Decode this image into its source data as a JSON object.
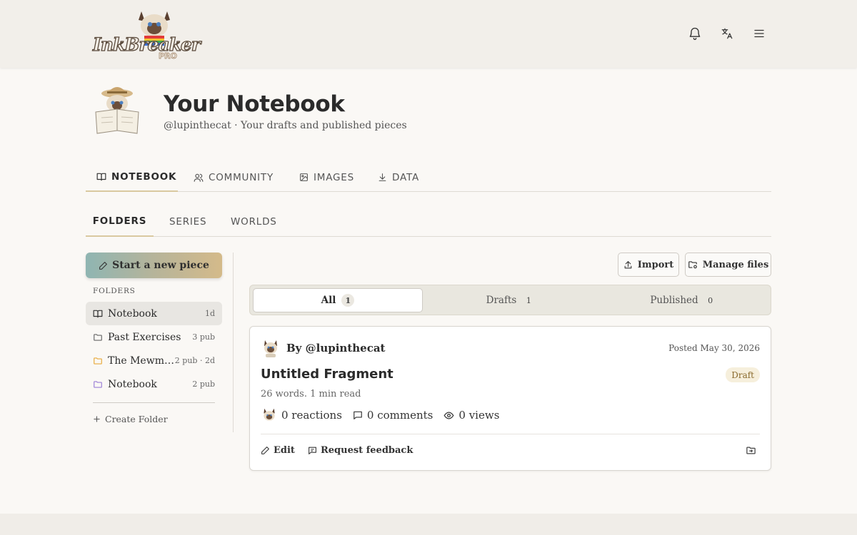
{
  "header": {
    "logo_text": "InkBreaker",
    "logo_sub": "PRO",
    "icons": [
      "bell-icon",
      "translate-icon",
      "menu-icon"
    ]
  },
  "profile": {
    "title": "Your Notebook",
    "subtitle": "@lupinthecat · Your drafts and published pieces"
  },
  "main_tabs": [
    {
      "label": "NOTEBOOK",
      "icon": "book-icon",
      "active": true
    },
    {
      "label": "COMMUNITY",
      "icon": "users-icon",
      "active": false
    },
    {
      "label": "IMAGES",
      "icon": "image-icon",
      "active": false
    },
    {
      "label": "DATA",
      "icon": "download-icon",
      "active": false
    }
  ],
  "sub_tabs": [
    {
      "label": "FOLDERS",
      "active": true
    },
    {
      "label": "SERIES",
      "active": false
    },
    {
      "label": "WORLDS",
      "active": false
    }
  ],
  "sidebar": {
    "new_piece_label": "Start a new piece",
    "folders_heading": "FOLDERS",
    "folders": [
      {
        "name": "Notebook",
        "meta": "1d",
        "icon": "book-icon",
        "active": true
      },
      {
        "name": "Past Exercises",
        "meta": "3 pub",
        "icon": "folder-icon",
        "color": "#666666"
      },
      {
        "name": "The Mewmer...",
        "meta": "2 pub · 2d",
        "icon": "folder-icon",
        "color": "#e8a93a"
      },
      {
        "name": "Notebook",
        "meta": "2 pub",
        "icon": "folder-icon",
        "color": "#9a7ed6"
      }
    ],
    "create_folder_label": "Create Folder"
  },
  "toolbar": {
    "import_label": "Import",
    "manage_label": "Manage files"
  },
  "filters": [
    {
      "label": "All",
      "count": "1",
      "active": true
    },
    {
      "label": "Drafts",
      "count": "1",
      "active": false
    },
    {
      "label": "Published",
      "count": "0",
      "active": false
    }
  ],
  "piece": {
    "author": "By @lupinthecat",
    "date": "Posted May 30, 2026",
    "title": "Untitled Fragment",
    "status": "Draft",
    "meta": "26 words. 1 min read",
    "reactions": "0 reactions",
    "comments": "0 comments",
    "views": "0 views",
    "edit_label": "Edit",
    "feedback_label": "Request feedback"
  },
  "colors": {
    "accent_underline": "#d9c9a0",
    "draft_badge_bg": "#f6efdc",
    "draft_badge_text": "#8a6a2d",
    "new_piece_gradient": [
      "#8fb5b2",
      "#d4ba8a"
    ]
  }
}
